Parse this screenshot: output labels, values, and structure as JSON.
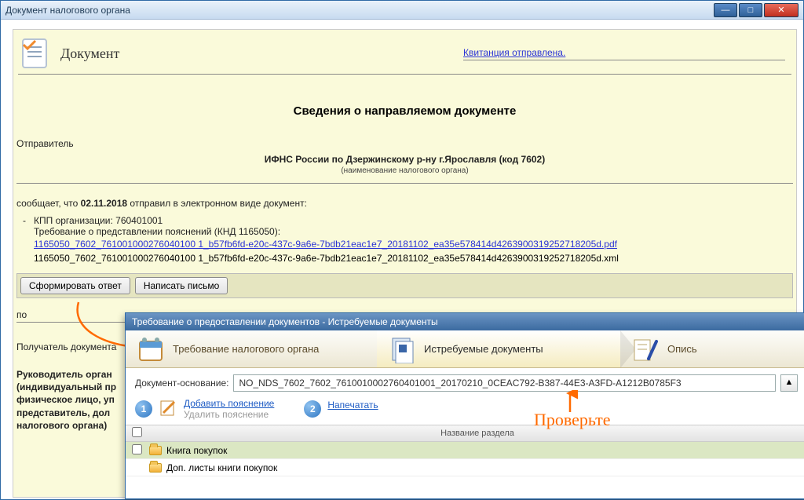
{
  "outer": {
    "title": "Документ налогового органа",
    "btn_min": "—",
    "btn_max": "□",
    "btn_close": "✕"
  },
  "doc": {
    "heading": "Документ",
    "receipt_link": "Квитанция отправлена.",
    "section_title": "Сведения о направляемом документе",
    "sender_label": "Отправитель",
    "sender_name": "ИФНС России по Дзержинскому р-ну г.Ярославля (код 7602)",
    "sender_sub": "(наименование налогового органа)",
    "msg_prefix": "сообщает, что ",
    "msg_date": "02.11.2018",
    "msg_suffix": " отправил в электронном виде документ:",
    "kpp_line": "КПП организации: 760401001",
    "req_line": "Требование о представлении пояснений (КНД 1165050):",
    "file_pdf": "1165050_7602_761001000276040100 1_b57fb6fd-e20c-437c-9a6e-7bdb21eac1e7_20181102_ea35e578414d4263900319252718205d.pdf",
    "file_xml": "1165050_7602_761001000276040100 1_b57fb6fd-e20c-437c-9a6e-7bdb21eac1e7_20181102_ea35e578414d4263900319252718205d.xml",
    "btn_form": "Сформировать ответ",
    "btn_letter": "Написать письмо",
    "po_label": "по",
    "recipient_label": "Получатель документа",
    "boss1": "Руководитель орган",
    "boss2": "(индивидуальный пр",
    "boss3": "физическое лицо, уп",
    "boss4": "представитель, дол",
    "boss5": "налогового органа)"
  },
  "popup": {
    "title": "Требование о предоставлении документов - Истребуемые документы",
    "step1": "Требование налогового органа",
    "step2": "Истребуемые документы",
    "step3": "Опись",
    "docbase_label": "Документ-основание:",
    "docbase_value": "NO_NDS_7602_7602_7610010002760401001_20170210_0CEAC792-B387-44E3-A3FD-A1212B0785F3",
    "up_btn": "▲",
    "num1": "1",
    "num2": "2",
    "add_note": "Добавить пояснение",
    "del_note": "Удалить пояснение",
    "print": "Напечатать",
    "col_name": "Название раздела",
    "row1": "Книга покупок",
    "row2": "Доп. листы книги покупок"
  },
  "annotation": {
    "check": "Проверьте"
  }
}
